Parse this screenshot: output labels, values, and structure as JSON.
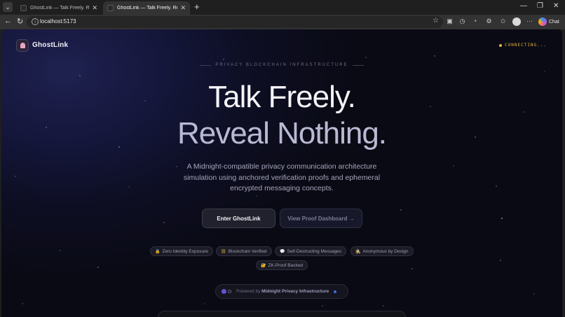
{
  "browser": {
    "tabs": [
      {
        "title": "GhostLink — Talk Freely. Reveal No",
        "active": false
      },
      {
        "title": "GhostLink — Talk Freely. Reveal No",
        "active": true
      }
    ],
    "url": "localhost:5173",
    "chat_label": "Chat",
    "icons": {
      "menu": "chevron-down-icon",
      "back": "back-arrow-icon",
      "reload": "reload-icon",
      "info": "info-icon",
      "favorite": "star-icon"
    }
  },
  "page": {
    "brand": "GhostLink",
    "status": "CONNECTING...",
    "status_color": "#e3b23c",
    "eyebrow": "PRIVACY BLOCKCHAIN INFRASTRUCTURE",
    "headline_1": "Talk Freely.",
    "headline_2": "Reveal Nothing.",
    "description": "A Midnight-compatible privacy communication architecture simulation using anchored verification proofs and ephemeral encrypted messaging concepts.",
    "primary_cta": "Enter GhostLink",
    "secondary_cta": "View Proof Dashboard →",
    "features": [
      {
        "icon": "🔒",
        "label": "Zero Identity Exposure"
      },
      {
        "icon": "⛓",
        "label": "Blockchain Verified"
      },
      {
        "icon": "💬",
        "label": "Self-Destructing Messages"
      },
      {
        "icon": "🕵",
        "label": "Anonymous by Design"
      },
      {
        "icon": "🔐",
        "label": "ZK-Proof Backed"
      }
    ],
    "powered_prefix": "Powered by",
    "powered_name": "Midnight Privacy Infrastructure"
  }
}
